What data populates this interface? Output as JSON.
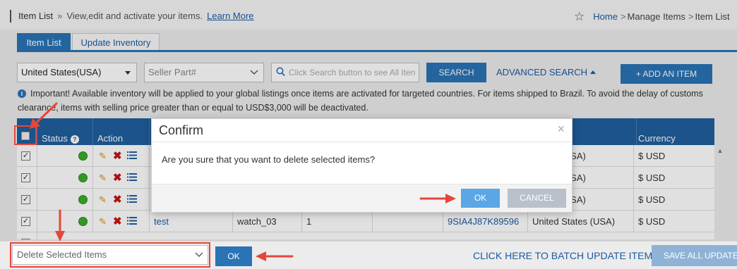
{
  "header": {
    "page_title": "Item List",
    "separator": "»",
    "description": "View,edit and activate your items.",
    "learn_more": "Learn More",
    "breadcrumb": {
      "home": "Home",
      "manage_items": "Manage Items",
      "current": "Item List"
    }
  },
  "tabs": [
    {
      "label": "Item List",
      "active": true
    },
    {
      "label": "Update Inventory",
      "active": false
    }
  ],
  "filters": {
    "country_value": "United States(USA)",
    "field_value": "Seller Part#",
    "search_placeholder": "Click Search button to see All Iten",
    "search_button": "SEARCH",
    "advanced_search": "ADVANCED SEARCH",
    "add_item": "+ ADD AN ITEM"
  },
  "notice": "Important! Available inventory will be applied to your global listings once items are activated for targeted countries. For items shipped to Brazil. To avoid the delay of customs clearance, items with selling price greater than or equal to USD$3,000 will be deactivated.",
  "table": {
    "headers": {
      "status": "Status",
      "action": "Action",
      "currency": "Currency"
    },
    "rows": [
      {
        "checked": true,
        "status": "active",
        "col3": "",
        "col4": "",
        "col5": "",
        "col6": "",
        "col7": "",
        "country": "States (USA)",
        "currency": "$ USD"
      },
      {
        "checked": true,
        "status": "active",
        "col3": "",
        "col4": "",
        "col5": "",
        "col6": "",
        "col7": "",
        "country": "States (USA)",
        "currency": "$ USD"
      },
      {
        "checked": true,
        "status": "active",
        "col3": "",
        "col4": "",
        "col5": "",
        "col6": "",
        "col7": "",
        "country": "States (USA)",
        "currency": "$ USD"
      },
      {
        "checked": true,
        "status": "active",
        "col3": "test",
        "col4": "watch_03",
        "col5": "1",
        "col6": "",
        "col7": "9SIA4J87K89596",
        "country": "United States (USA)",
        "currency": "$ USD"
      }
    ]
  },
  "modal": {
    "title": "Confirm",
    "close": "×",
    "message": "Are you sure that you want to delete selected items?",
    "ok": "OK",
    "cancel": "CANCEL"
  },
  "bottom": {
    "bulk_action_value": "Delete Selected Items",
    "ok": "OK",
    "batch_update": "CLICK HERE TO BATCH UPDATE ITEMS",
    "save_all": "SAVE ALL UPDATES"
  },
  "colors": {
    "brand_blue": "#2a73b5",
    "header_blue": "#1f5f9e",
    "annotation_red": "#e5463a",
    "status_green": "#3cab2b"
  },
  "icons": [
    "star-icon",
    "info-icon",
    "search-icon",
    "help-icon",
    "edit-icon",
    "delete-icon",
    "list-icon",
    "close-icon",
    "chevron-down-icon"
  ]
}
